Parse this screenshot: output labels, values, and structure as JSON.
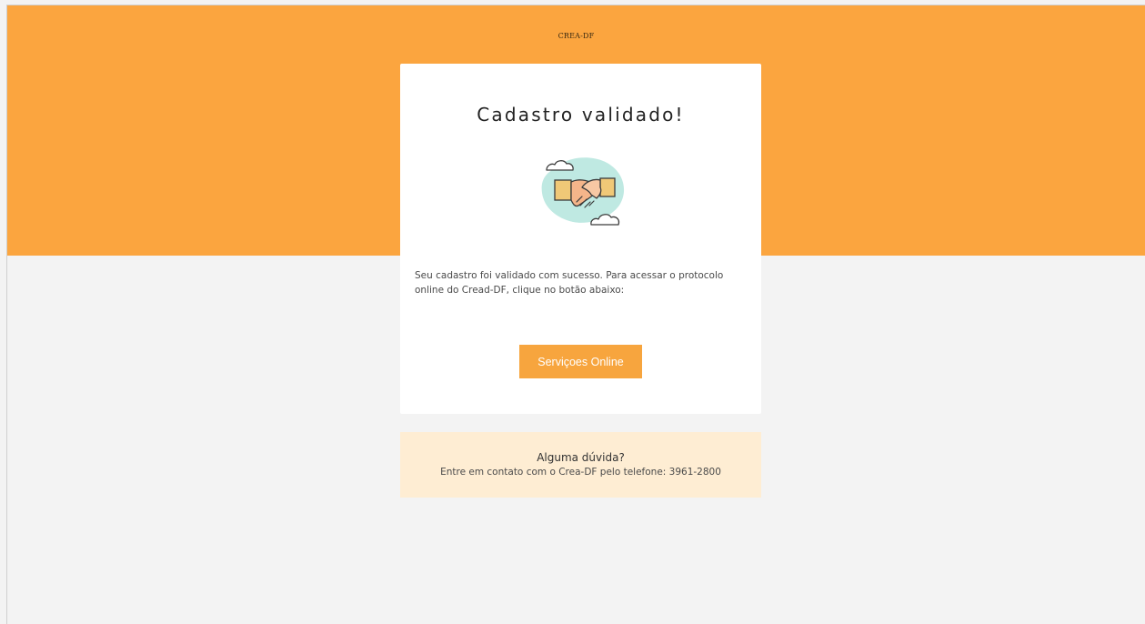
{
  "header": {
    "brand": "CREA-DF",
    "background_color": "#fba53f"
  },
  "card": {
    "title": "Cadastro validado!",
    "illustration_icon": "handshake-icon",
    "message": "Seu cadastro foi validado com sucesso. Para acessar o protocolo online do Cread-DF, clique no botão abaixo:",
    "button_label": "Serviçoes Online",
    "button_color": "#f7a53e"
  },
  "help": {
    "title": "Alguma dúvida?",
    "text": "Entre em contato com o Crea-DF pelo telefone: 3961-2800",
    "background_color": "#feedd3"
  }
}
